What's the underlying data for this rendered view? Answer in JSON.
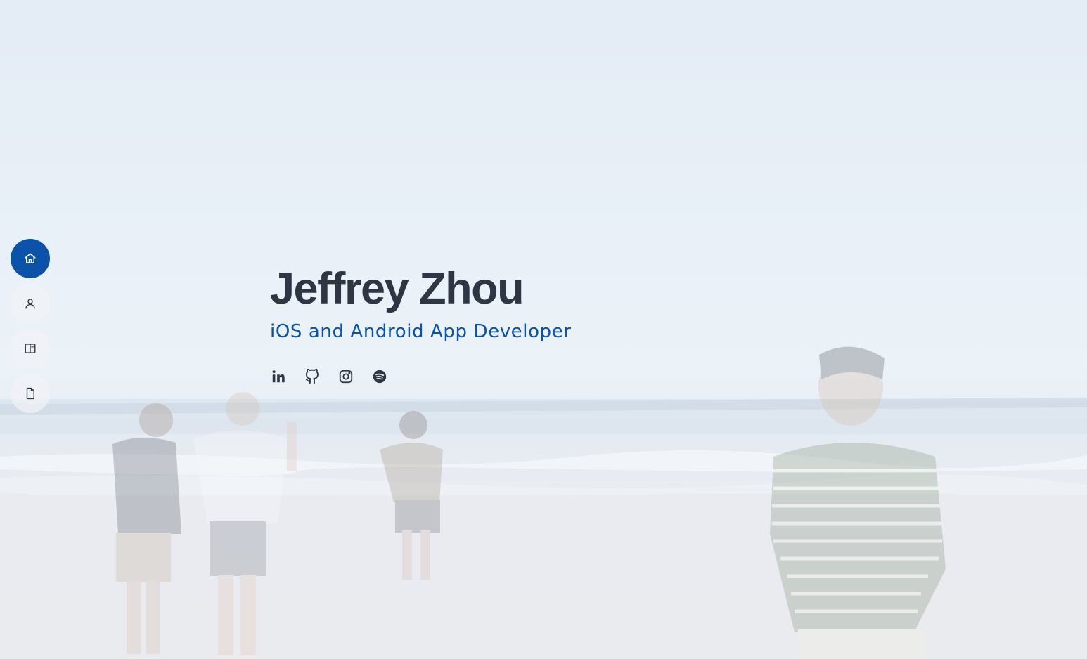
{
  "hero": {
    "name": "Jeffrey Zhou",
    "role": "iOS and Android App Developer"
  },
  "nav": {
    "items": [
      {
        "icon": "home-icon",
        "active": true
      },
      {
        "icon": "user-icon",
        "active": false
      },
      {
        "icon": "book-icon",
        "active": false
      },
      {
        "icon": "file-icon",
        "active": false
      }
    ],
    "active_color": "#0a53a8"
  },
  "social": {
    "links": [
      {
        "icon": "linkedin-icon"
      },
      {
        "icon": "github-icon"
      },
      {
        "icon": "instagram-icon"
      },
      {
        "icon": "spotify-icon"
      }
    ]
  },
  "colors": {
    "heading": "#2d3642",
    "accent": "#0a53a8"
  }
}
